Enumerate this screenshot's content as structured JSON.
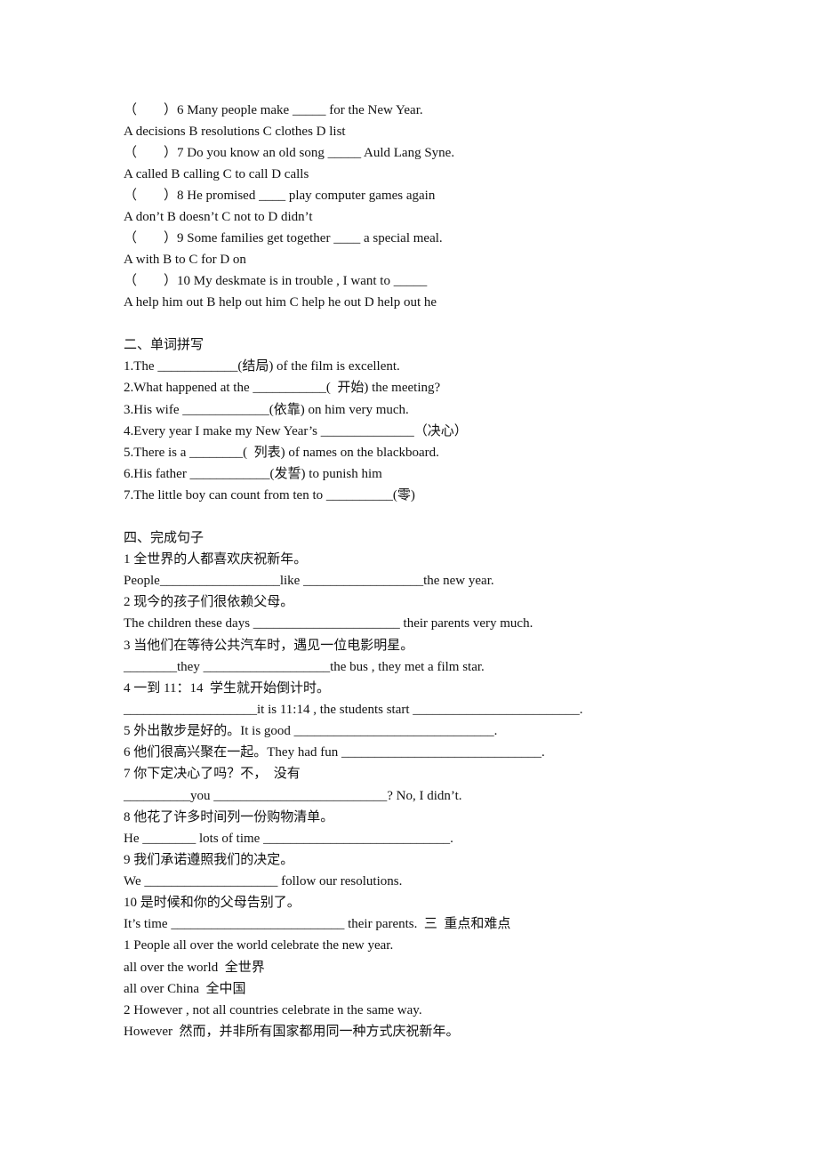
{
  "choice_questions": [
    {
      "stem": "（　　）6 Many people make _____ for the New Year.",
      "options": "A decisions B resolutions C clothes D list"
    },
    {
      "stem": "（　　）7 Do you know an old song _____ Auld Lang Syne.",
      "options": "A called B calling C to call D calls"
    },
    {
      "stem": "（　　）8 He promised ____ play computer games again",
      "options": "A don’t B doesn’t C not to D didn’t"
    },
    {
      "stem": "（　　）9 Some families get together ____ a special meal.",
      "options": "A with B to C for D on"
    },
    {
      "stem": "（　　）10 My deskmate is in trouble , I want to _____",
      "options": "A help him out B help out him C help he out D help out he"
    }
  ],
  "spelling_section": {
    "heading": "二、单词拼写",
    "items": [
      "1.The ____________(结局) of the film is excellent.",
      "2.What happened at the ___________(  开始) the meeting?",
      "3.His wife _____________(依靠) on him very much.",
      "4.Every year I make my New Year’s ______________（决心）",
      "5.There is a ________(  列表) of names on the blackboard.",
      "6.His father ____________(发誓) to punish him",
      "7.The little boy can count from ten to __________(零)"
    ]
  },
  "sentence_section": {
    "heading": "四、完成句子",
    "items": [
      {
        "cn": "1 全世界的人都喜欢庆祝新年。",
        "en": "People__________________like __________________the new year."
      },
      {
        "cn": "2 现今的孩子们很依赖父母。",
        "en": "The children these days ______________________ their parents very much."
      },
      {
        "cn": "3 当他们在等待公共汽车时，遇见一位电影明星。",
        "en": "________they ___________________the bus , they met a film star."
      },
      {
        "cn": "4 一到 11：14  学生就开始倒计时。",
        "en": "____________________it is 11:14 , the students start _________________________."
      },
      {
        "cn_en": "5 外出散步是好的。It is good ______________________________."
      },
      {
        "cn_en": "6 他们很高兴聚在一起。They had fun ______________________________."
      },
      {
        "cn": "7 你下定决心了吗？不，  没有",
        "en": "__________you __________________________? No, I didn’t."
      },
      {
        "cn": "8 他花了许多时间列一份购物清单。",
        "en": "He ________ lots of time ____________________________."
      },
      {
        "cn": "9 我们承诺遵照我们的决定。",
        "en": "We ____________________ follow our resolutions."
      },
      {
        "cn": "10 是时候和你的父母告别了。",
        "en": "It’s time __________________________ their parents.  三  重点和难点"
      }
    ]
  },
  "key_points": [
    "1 People all over the world celebrate the new year.",
    "all over the world  全世界",
    "all over China  全中国",
    "2 However , not all countries celebrate in the same way.",
    "However  然而，并非所有国家都用同一种方式庆祝新年。"
  ]
}
